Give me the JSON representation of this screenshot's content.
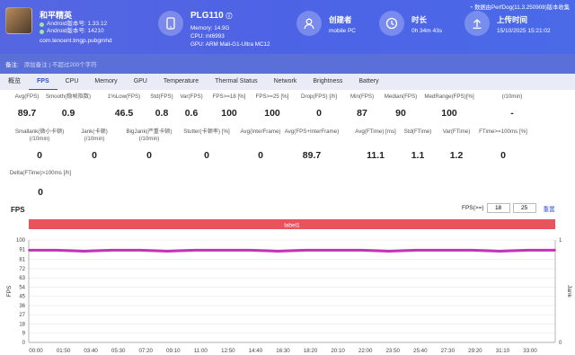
{
  "header": {
    "game_name": "和平精英",
    "android_version_label": "Android版本号: 1.33.12",
    "android_code_label": "Android版本号: 14210",
    "package": "com.tencent.tmgp.pubgmhd",
    "device_name": "PLG110",
    "device_memory": "Memory: 14.9G",
    "device_cpu": "CPU: mt6993",
    "device_gpu": "GPU: ARM Mali-G1-Ultra MC12",
    "creator_label": "创建者",
    "creator_value": "mobile PC",
    "duration_label": "时长",
    "duration_value": "0h 34m 43s",
    "upload_label": "上传时间",
    "upload_value": "15/10/2025 15:21:02",
    "version_text": "数据由PerfDog(11.3.250908)版本收集",
    "notes_label": "备注:",
    "notes_placeholder": "添加备注 | 不超过200个字符"
  },
  "tabs": [
    "概览",
    "FPS",
    "CPU",
    "Memory",
    "GPU",
    "Temperature",
    "Thermal Status",
    "Network",
    "Brightness",
    "Battery"
  ],
  "active_tab": "FPS",
  "stats_row1": [
    {
      "label": "Avg(FPS)",
      "value": "89.7"
    },
    {
      "label": "Smooth(稳帧指数)",
      "value": "0.9"
    },
    {
      "label": "1%Low(FPS)",
      "value": "46.5"
    },
    {
      "label": "Std(FPS)",
      "value": "0.8"
    },
    {
      "label": "Var(FPS)",
      "value": "0.6"
    },
    {
      "label": "FPS>=18 [%]",
      "value": "100"
    },
    {
      "label": "FPS>=25 [%]",
      "value": "100"
    },
    {
      "label": "Drop(FPS) [/h]",
      "value": "0"
    },
    {
      "label": "Min(FPS)",
      "value": "87"
    },
    {
      "label": "Median(FPS)",
      "value": "90"
    },
    {
      "label": "MedRange(FPS)[%]",
      "value": "100"
    },
    {
      "label": "(/10min)",
      "value": "-"
    }
  ],
  "stats_row2": [
    {
      "label": "Smallank(微小卡顿)\n(/10min)",
      "value": "0"
    },
    {
      "label": "Jank(卡顿)\n(/10min)",
      "value": "0"
    },
    {
      "label": "BigJank(严重卡顿)\n(/10min)",
      "value": "0"
    },
    {
      "label": "Stutter(卡顿率) [%]",
      "value": "0"
    },
    {
      "label": "Avg(InterFrame)",
      "value": "0"
    },
    {
      "label": "Avg(FPS+InterFrame)",
      "value": "89.7"
    },
    {
      "label": "Avg(FTime) [ms]",
      "value": "11.1"
    },
    {
      "label": "Std(FTime)",
      "value": "1.1"
    },
    {
      "label": "Var(FTime)",
      "value": "1.2"
    },
    {
      "label": "FTime>=100ms [%]",
      "value": "0"
    }
  ],
  "stats_row3": [
    {
      "label": "Delta(FTime)>100ms [/h]",
      "value": "0"
    }
  ],
  "chart": {
    "title": "FPS",
    "fps_ctrl_label": "FPS(>=)",
    "fps_input_1": "18",
    "fps_input_2": "25",
    "reset_label": "重置",
    "band_label": "label1",
    "colors": {
      "band": "#e8545e",
      "line": "#c233b8",
      "grid": "#e6e6e6"
    }
  },
  "chart_data": {
    "type": "line",
    "ylabel": "FPS",
    "y2label": "Jank",
    "ylim": [
      0,
      100
    ],
    "y2lim": [
      0,
      1
    ],
    "y_ticks": [
      0,
      9,
      18,
      27,
      36,
      45,
      54,
      63,
      72,
      81,
      91,
      100
    ],
    "y2_ticks": [
      0,
      1
    ],
    "x_ticks": [
      "00:00",
      "01:50",
      "03:40",
      "05:30",
      "07:20",
      "09:10",
      "11:00",
      "12:50",
      "14:40",
      "16:30",
      "18:20",
      "20:10",
      "22:00",
      "23:50",
      "25:40",
      "27:30",
      "29:20",
      "31:10",
      "33:00"
    ],
    "series": [
      {
        "name": "label1",
        "values": [
          90,
          90,
          89,
          90,
          90,
          89,
          90,
          90,
          90,
          89,
          90,
          90,
          90,
          89,
          90,
          90,
          90,
          89,
          90,
          90
        ]
      }
    ]
  }
}
